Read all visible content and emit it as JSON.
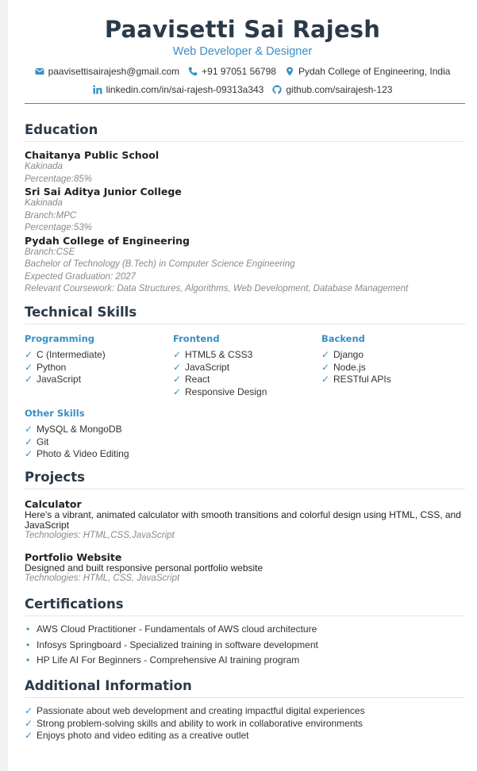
{
  "header": {
    "name": "Paavisetti Sai Rajesh",
    "title": "Web Developer & Designer",
    "contacts": {
      "email": "paavisettisairajesh@gmail.com",
      "phone": "+91 97051 56798",
      "location": "Pydah College of Engineering, India",
      "linkedin": "linkedin.com/in/sai-rajesh-09313a343",
      "github": "github.com/sairajesh-123"
    }
  },
  "education": {
    "title": "Education",
    "entries": [
      {
        "school": "Chaitanya Public School",
        "lines": [
          "Kakinada",
          "Percentage:85%"
        ]
      },
      {
        "school": "Sri Sai Aditya Junior College",
        "lines": [
          "Kakinada",
          "Branch:MPC",
          "Percentage:53%"
        ]
      },
      {
        "school": "Pydah College of Engineering",
        "lines": [
          "Branch:CSE",
          "Bachelor of Technology (B.Tech) in Computer Science Engineering",
          "Expected Graduation: 2027",
          "Relevant Coursework: Data Structures, Algorithms, Web Development, Database Management"
        ]
      }
    ]
  },
  "skills": {
    "title": "Technical Skills",
    "groups": [
      {
        "name": "Programming",
        "items": [
          "C (Intermediate)",
          "Python",
          "JavaScript"
        ]
      },
      {
        "name": "Frontend",
        "items": [
          "HTML5 & CSS3",
          "JavaScript",
          "React",
          "Responsive Design"
        ]
      },
      {
        "name": "Backend",
        "items": [
          "Django",
          "Node.js",
          "RESTful APIs"
        ]
      },
      {
        "name": "Other Skills",
        "items": [
          "MySQL & MongoDB",
          "Git",
          "Photo & Video Editing"
        ]
      }
    ],
    "check_glyph": "✓"
  },
  "projects": {
    "title": "Projects",
    "entries": [
      {
        "name": "Calculator",
        "description": "Here's a vibrant, animated calculator with smooth transitions and colorful design using HTML, CSS, and JavaScript",
        "tech": "Technologies: HTML,CSS,JavaScript"
      },
      {
        "name": "Portfolio Website",
        "description": "Designed and built responsive personal portfolio website",
        "tech": "Technologies: HTML, CSS, JavaScript"
      }
    ]
  },
  "certifications": {
    "title": "Certifications",
    "bullet_glyph": "•",
    "items": [
      "AWS Cloud Practitioner - Fundamentals of AWS cloud architecture",
      "Infosys Springboard - Specialized training in software development",
      "HP Life AI For Beginners - Comprehensive AI training program"
    ]
  },
  "additional": {
    "title": "Additional Information",
    "items": [
      "Passionate about web development and creating impactful digital experiences",
      "Strong problem-solving skills and ability to work in collaborative environments",
      "Enjoys photo and video editing as a creative outlet"
    ]
  },
  "colors": {
    "accent": "#3a8fc4",
    "heading": "#2b3a4a",
    "muted": "#8a8a8a"
  },
  "icons": [
    "envelope-icon",
    "phone-icon",
    "location-pin-icon",
    "linkedin-icon",
    "github-icon"
  ]
}
